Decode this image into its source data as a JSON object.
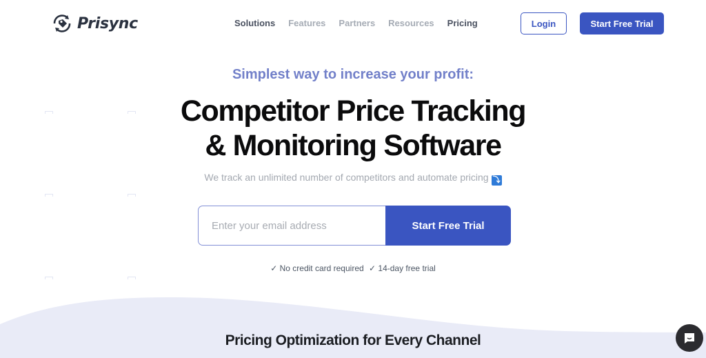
{
  "header": {
    "logo_text": "Prisync",
    "nav": [
      {
        "label": "Solutions",
        "active": true
      },
      {
        "label": "Features",
        "active": false
      },
      {
        "label": "Partners",
        "active": false
      },
      {
        "label": "Resources",
        "active": false
      },
      {
        "label": "Pricing",
        "active": true
      }
    ],
    "login_label": "Login",
    "trial_label": "Start Free Trial"
  },
  "hero": {
    "eyebrow": "Simplest way to increase your profit:",
    "headline_line1": "Competitor Price Tracking",
    "headline_line2": "& Monitoring Software",
    "subline": "We track an unlimited number of competitors and automate pricing",
    "subline_icon": "arrow-down-icon",
    "email_placeholder": "Enter your email address",
    "email_value": "",
    "cta_label": "Start Free Trial",
    "checks": [
      "✓ No credit card required",
      "✓ 14-day free trial"
    ]
  },
  "section": {
    "title": "Pricing Optimization for Every Channel"
  },
  "chat": {
    "icon": "chat-icon"
  },
  "colors": {
    "brand": "#3a55c1",
    "eyebrow": "#7280c9",
    "wave_bg": "#e9ebf7"
  }
}
